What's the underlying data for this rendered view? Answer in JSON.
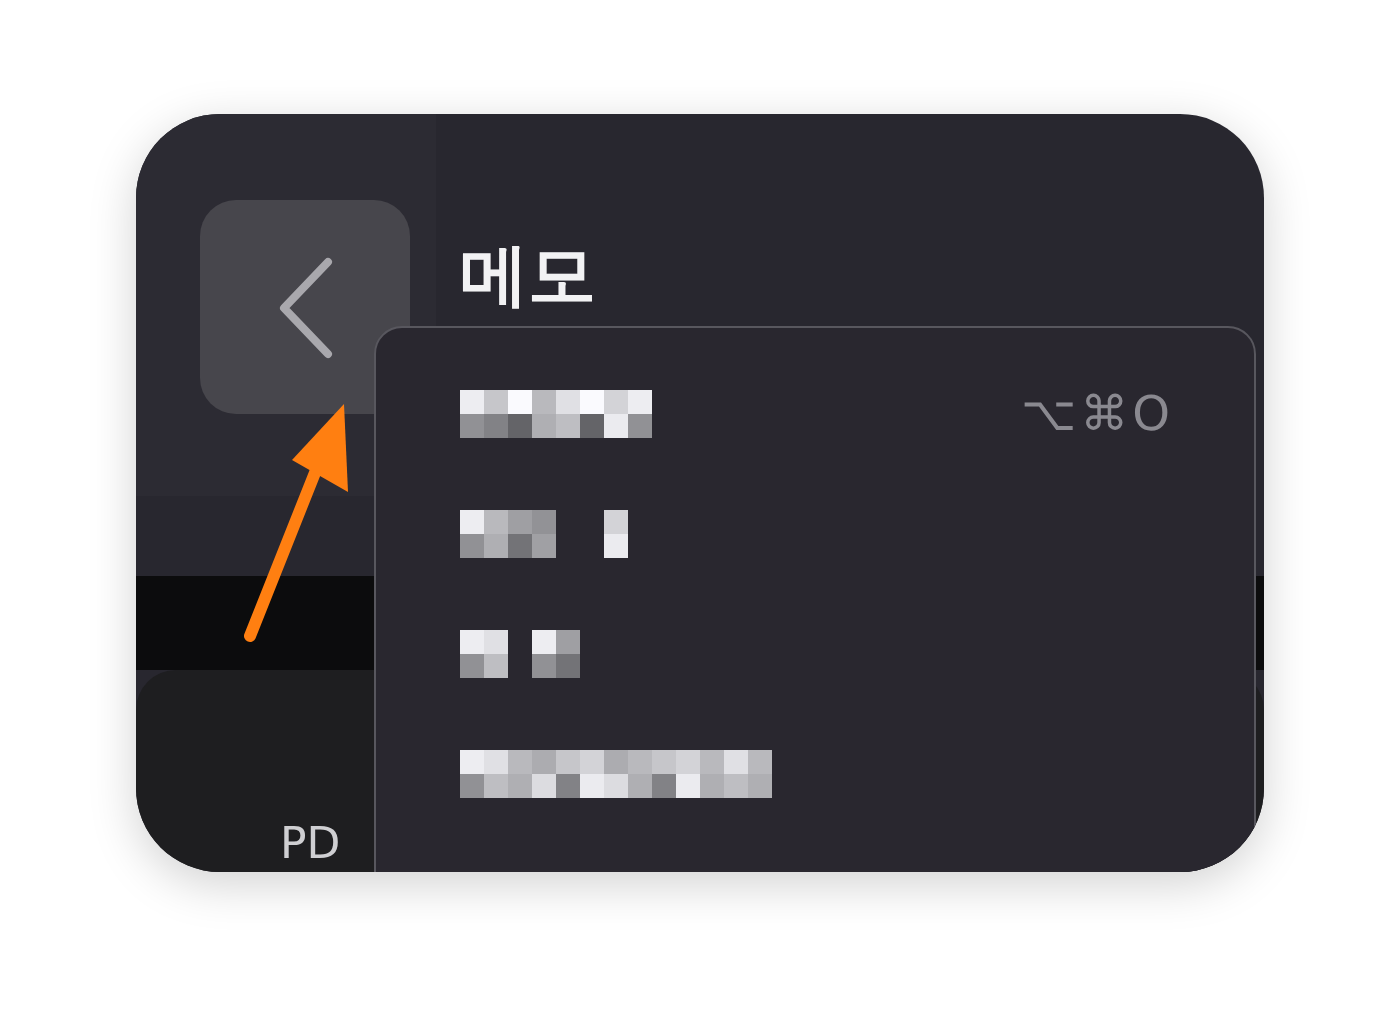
{
  "header": {
    "title": "메모"
  },
  "menu": {
    "items": [
      {
        "kind": "pixelated",
        "shortcut": "⌥⌘O"
      },
      {
        "kind": "pixelated"
      },
      {
        "kind": "pixelated"
      },
      {
        "kind": "pixelated"
      }
    ]
  },
  "card": {
    "label": "PD"
  },
  "annotation": {
    "kind": "arrow",
    "color": "#ff7f11"
  }
}
